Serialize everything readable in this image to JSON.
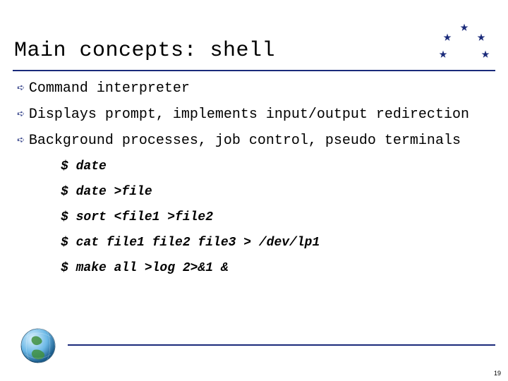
{
  "title": "Main concepts: shell",
  "bullets": [
    "Command interpreter",
    "Displays prompt, implements input/output redirection",
    "Background processes, job control, pseudo terminals"
  ],
  "code": [
    "$ date",
    "$ date >file",
    "$ sort <file1 >file2",
    "$ cat file1 file2 file3 > /dev/lp1",
    "$ make all >log 2>&1 &"
  ],
  "page_number": "19"
}
